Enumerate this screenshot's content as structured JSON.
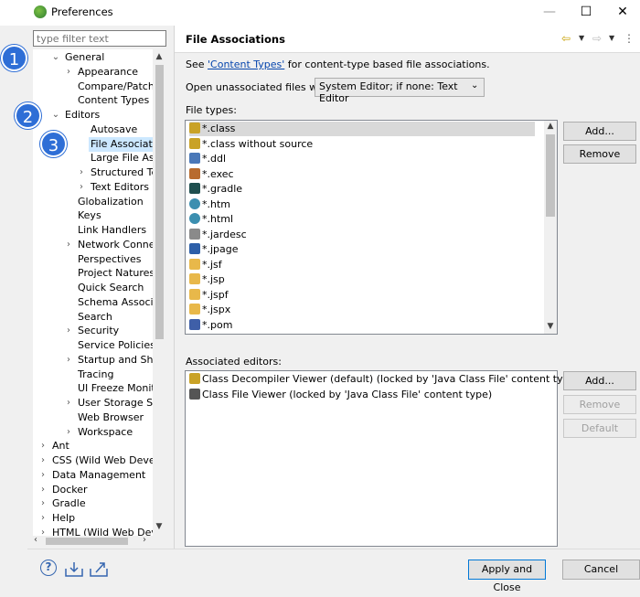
{
  "window": {
    "title": "Preferences",
    "min": "—",
    "max": "☐",
    "close": "✕"
  },
  "sidebar": {
    "filter_placeholder": "type filter text",
    "items": [
      {
        "label": "General",
        "twisty": "⌄"
      },
      {
        "label": "Appearance",
        "twisty": "›"
      },
      {
        "label": "Compare/Patch",
        "twisty": ""
      },
      {
        "label": "Content Types",
        "twisty": ""
      },
      {
        "label": "Editors",
        "twisty": "⌄"
      },
      {
        "label": "Autosave",
        "twisty": ""
      },
      {
        "label": "File Associations",
        "twisty": ""
      },
      {
        "label": "Large File Associa",
        "twisty": ""
      },
      {
        "label": "Structured Text Ec",
        "twisty": "›"
      },
      {
        "label": "Text Editors",
        "twisty": "›"
      },
      {
        "label": "Globalization",
        "twisty": ""
      },
      {
        "label": "Keys",
        "twisty": ""
      },
      {
        "label": "Link Handlers",
        "twisty": ""
      },
      {
        "label": "Network Connection",
        "twisty": "›"
      },
      {
        "label": "Perspectives",
        "twisty": ""
      },
      {
        "label": "Project Natures",
        "twisty": ""
      },
      {
        "label": "Quick Search",
        "twisty": ""
      },
      {
        "label": "Schema Associations",
        "twisty": ""
      },
      {
        "label": "Search",
        "twisty": ""
      },
      {
        "label": "Security",
        "twisty": "›"
      },
      {
        "label": "Service Policies",
        "twisty": ""
      },
      {
        "label": "Startup and Shutdo",
        "twisty": "›"
      },
      {
        "label": "Tracing",
        "twisty": ""
      },
      {
        "label": "UI Freeze Monitoring",
        "twisty": ""
      },
      {
        "label": "User Storage Service",
        "twisty": "›"
      },
      {
        "label": "Web Browser",
        "twisty": ""
      },
      {
        "label": "Workspace",
        "twisty": "›"
      },
      {
        "label": "Ant",
        "twisty": "›"
      },
      {
        "label": "CSS (Wild Web Develop",
        "twisty": "›"
      },
      {
        "label": "Data Management",
        "twisty": "›"
      },
      {
        "label": "Docker",
        "twisty": "›"
      },
      {
        "label": "Gradle",
        "twisty": "›"
      },
      {
        "label": "Help",
        "twisty": "›"
      },
      {
        "label": "HTML (Wild Web Develo",
        "twisty": "›"
      }
    ]
  },
  "badges": [
    "1",
    "2",
    "3"
  ],
  "page": {
    "title": "File Associations",
    "see_prefix": "See ",
    "see_link": "'Content Types'",
    "see_suffix": " for content-type based file associations.",
    "open_label": "Open unassociated files with:",
    "open_value": "System Editor; if none: Text Editor",
    "file_types_label": "File types:",
    "file_types": [
      {
        "name": "*.class",
        "icon": "class-icon",
        "color": "#c9a227"
      },
      {
        "name": "*.class without source",
        "icon": "class-icon",
        "color": "#c9a227"
      },
      {
        "name": "*.ddl",
        "icon": "ddl-icon",
        "color": "#4a78b8"
      },
      {
        "name": "*.exec",
        "icon": "exec-icon",
        "color": "#b86b2e"
      },
      {
        "name": "*.gradle",
        "icon": "gradle-icon",
        "color": "#1f4f4f"
      },
      {
        "name": "*.htm",
        "icon": "globe-icon",
        "color": "#3c8fb0"
      },
      {
        "name": "*.html",
        "icon": "globe-icon",
        "color": "#3c8fb0"
      },
      {
        "name": "*.jardesc",
        "icon": "jar-icon",
        "color": "#8a8a8a"
      },
      {
        "name": "*.jpage",
        "icon": "jpage-icon",
        "color": "#2d5fa8"
      },
      {
        "name": "*.jsf",
        "icon": "document-icon",
        "color": "#e8b84a"
      },
      {
        "name": "*.jsp",
        "icon": "document-icon",
        "color": "#e8b84a"
      },
      {
        "name": "*.jspf",
        "icon": "document-icon",
        "color": "#e8b84a"
      },
      {
        "name": "*.jspx",
        "icon": "document-icon",
        "color": "#e8b84a"
      },
      {
        "name": "*.pom",
        "icon": "maven-icon",
        "color": "#3f5fa8"
      }
    ],
    "buttons": {
      "add": "Add...",
      "remove": "Remove",
      "add2": "Add...",
      "remove2": "Remove",
      "default": "Default"
    },
    "associated_label": "Associated editors:",
    "associated": [
      {
        "name": "Class Decompiler Viewer (default) (locked by 'Java Class File' content type)",
        "icon": "decompiler-icon"
      },
      {
        "name": "Class File Viewer (locked by 'Java Class File' content type)",
        "icon": "class-file-icon"
      }
    ],
    "nav": {
      "back": "⇦",
      "forward": "⇨",
      "menu": "⋮",
      "drop": "▼"
    }
  },
  "footer": {
    "help": "?",
    "apply_close": "Apply and Close",
    "cancel": "Cancel"
  }
}
